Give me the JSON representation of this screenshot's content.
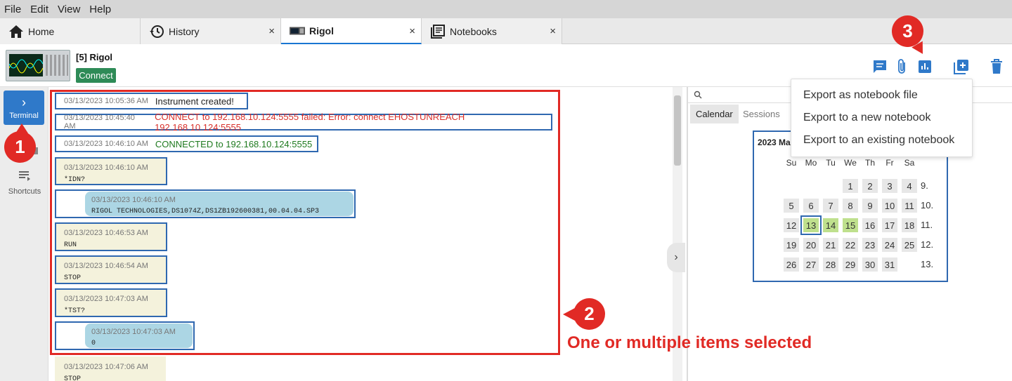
{
  "menubar": {
    "items": [
      "File",
      "Edit",
      "View",
      "Help"
    ]
  },
  "tabs": [
    {
      "label": "Home",
      "icon": "home-icon",
      "closable": false
    },
    {
      "label": "History",
      "icon": "history-icon",
      "closable": true
    },
    {
      "label": "Rigol",
      "icon": "oscilloscope-icon",
      "closable": true,
      "active": true
    },
    {
      "label": "Notebooks",
      "icon": "notebook-icon",
      "closable": true
    }
  ],
  "tab_close_glyph": "×",
  "instrument": {
    "title": "[5] Rigol",
    "connect_label": "Connect"
  },
  "header_icons": [
    "comment-icon",
    "attachment-icon",
    "chart-export-icon",
    "add-note-icon",
    "delete-icon"
  ],
  "sidebar": {
    "terminal_label": "Terminal",
    "shortcuts_label": "Shortcuts"
  },
  "messages": [
    {
      "ts": "03/13/2023 10:05:36 AM",
      "text": "Instrument created!",
      "kind": "sys"
    },
    {
      "ts": "03/13/2023 10:45:40 AM",
      "text": "CONNECT to 192.168.10.124:5555 failed: Error: connect EHOSTUNREACH 192.168.10.124:5555",
      "kind": "sys-error"
    },
    {
      "ts": "03/13/2023 10:46:10 AM",
      "text": "CONNECTED to 192.168.10.124:5555",
      "kind": "sys-ok"
    },
    {
      "ts": "03/13/2023 10:46:10 AM",
      "text": "*IDN?",
      "kind": "cmd"
    },
    {
      "ts": "03/13/2023 10:46:10 AM",
      "text": "RIGOL TECHNOLOGIES,DS1074Z,DS1ZB192600381,00.04.04.SP3",
      "kind": "resp"
    },
    {
      "ts": "03/13/2023 10:46:53 AM",
      "text": "RUN",
      "kind": "cmd"
    },
    {
      "ts": "03/13/2023 10:46:54 AM",
      "text": "STOP",
      "kind": "cmd"
    },
    {
      "ts": "03/13/2023 10:47:03 AM",
      "text": "*TST?",
      "kind": "cmd"
    },
    {
      "ts": "03/13/2023 10:47:03 AM",
      "text": "0",
      "kind": "resp"
    },
    {
      "ts": "03/13/2023 10:47:06 AM",
      "text": "STOP",
      "kind": "cmd"
    }
  ],
  "right_panel": {
    "tabs": [
      "Calendar",
      "Sessions"
    ],
    "calendar": {
      "title": "2023 Ma",
      "dow": [
        "Su",
        "Mo",
        "Tu",
        "We",
        "Th",
        "Fr",
        "Sa"
      ],
      "weeks": [
        {
          "days": [
            "",
            "",
            "",
            "1",
            "2",
            "3",
            "4"
          ],
          "wk": "9."
        },
        {
          "days": [
            "5",
            "6",
            "7",
            "8",
            "9",
            "10",
            "11"
          ],
          "wk": "10."
        },
        {
          "days": [
            "12",
            "13",
            "14",
            "15",
            "16",
            "17",
            "18"
          ],
          "wk": "11."
        },
        {
          "days": [
            "19",
            "20",
            "21",
            "22",
            "23",
            "24",
            "25"
          ],
          "wk": "12."
        },
        {
          "days": [
            "26",
            "27",
            "28",
            "29",
            "30",
            "31",
            ""
          ],
          "wk": "13."
        }
      ],
      "highlighted_days": [
        "13",
        "14",
        "15"
      ],
      "today": "13"
    }
  },
  "export_menu": {
    "options": [
      "Export as notebook file",
      "Export to a new notebook",
      "Export to an existing notebook"
    ]
  },
  "annotations": {
    "badge1": "1",
    "badge2": "2",
    "badge3": "3",
    "caption": "One or multiple items selected"
  },
  "colors": {
    "accent": "#2f79c9",
    "annotation": "#e12a25",
    "connect": "#2e8b57",
    "error_text": "#d9302b",
    "ok_text": "#1f7a1f",
    "command_bg": "#f4f2dc",
    "response_bg": "#acd6e4"
  }
}
